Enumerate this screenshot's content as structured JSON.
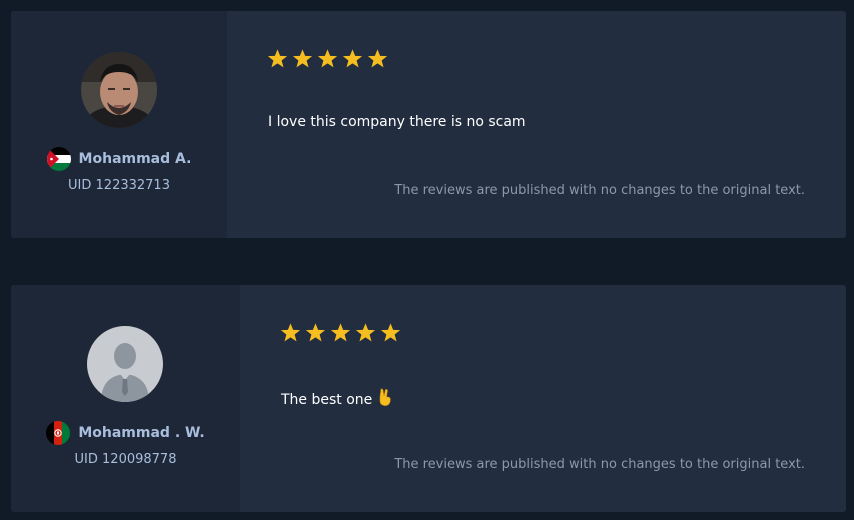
{
  "reviews": [
    {
      "rating": 5,
      "user": {
        "name": "Mohammad A.",
        "uid": "UID 122332713",
        "country_flag": "jordan-flag-icon",
        "avatar": "user-photo"
      },
      "text": "I love this company there is no scam",
      "disclaimer": "The reviews are published with no changes to the original text."
    },
    {
      "rating": 5,
      "user": {
        "name": "Mohammad . W.",
        "uid": "UID 120098778",
        "country_flag": "afghanistan-flag-icon",
        "avatar": "default-avatar-icon"
      },
      "text": "The best one",
      "emoji": "victory-hand-icon",
      "disclaimer": "The reviews are published with no changes to the original text."
    }
  ],
  "colors": {
    "background": "#111a27",
    "card": "#222d40",
    "user_panel": "#1e2738",
    "star": "#f5bd1f",
    "name": "#a9bddc",
    "disclaimer": "#8e98a8"
  }
}
